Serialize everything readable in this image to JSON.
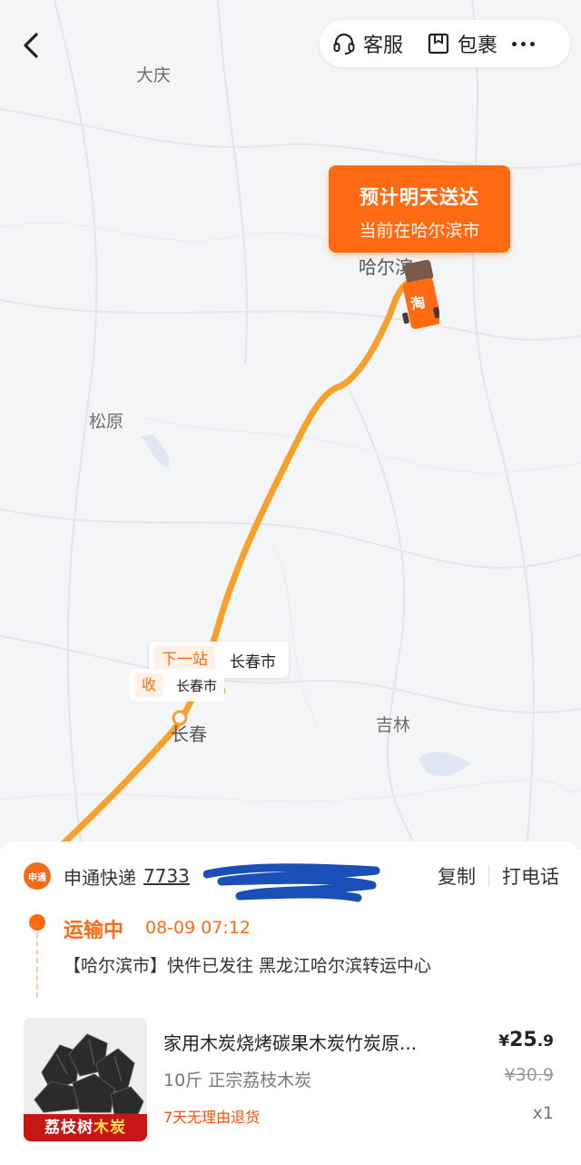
{
  "topbar": {
    "service_label": "客服",
    "package_label": "包裹"
  },
  "map": {
    "cities": {
      "daqing": "大庆",
      "harbin": "哈尔滨",
      "songyuan": "松原",
      "changchun": "长春",
      "jilin": "吉林"
    },
    "eta": {
      "title": "预计明天送达",
      "subtitle": "当前在哈尔滨市"
    },
    "truck_badge": "淘",
    "next_stop": {
      "tag": "下一站",
      "city": "长春市"
    },
    "receive": {
      "tag": "收",
      "city": "长春市"
    },
    "colors": {
      "accent": "#ff6a13",
      "route": "#f7a02b"
    }
  },
  "shipment": {
    "courier_logo_text": "申通",
    "courier_name": "申通快递",
    "tracking_number_visible": "7733",
    "copy_label": "复制",
    "call_label": "打电话",
    "status": "运输中",
    "status_time": "08-09 07:12",
    "status_detail": "【哈尔滨市】快件已发往 黑龙江哈尔滨转运中心"
  },
  "product": {
    "image_banner_a": "荔枝树",
    "image_banner_b": "木炭",
    "title": "家用木炭烧烤碳果木炭竹炭原...",
    "spec": "10斤 正宗荔枝木炭",
    "badge": "7天无理由退货",
    "currency": "¥",
    "price_int": "25",
    "price_dec": ".9",
    "original_price": "¥30.9",
    "quantity": "x1"
  }
}
